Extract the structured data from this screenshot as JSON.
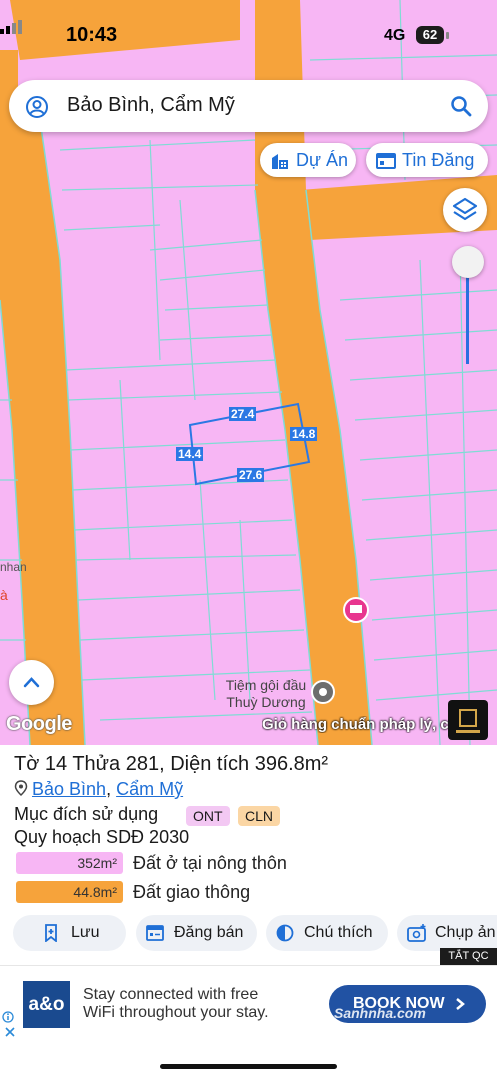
{
  "status_bar": {
    "time": "10:43",
    "network": "4G",
    "battery": "62"
  },
  "search": {
    "query": "Bảo Bình, Cẩm Mỹ",
    "avatar_icon": "account-circle-icon",
    "search_icon": "search-icon"
  },
  "map_chips": [
    {
      "label": "Dự Án",
      "icon": "building-icon"
    },
    {
      "label": "Tin Đăng",
      "icon": "listing-icon"
    }
  ],
  "map": {
    "layers_icon": "layers-icon",
    "recenter_icon": "chevron-up-icon",
    "parcel_dims": {
      "top": "27.4",
      "right": "14.8",
      "left": "14.4",
      "bottom": "27.6"
    },
    "poi_name_line1": "Tiệm gội đầu",
    "poi_name_line2": "Thuỳ Dương",
    "attribution": "Google",
    "marquee": "Giỏ hàng chuẩn pháp lý, c",
    "edge_labels": [
      "nhan",
      "à"
    ],
    "colors": {
      "residential": "#f7b6f4",
      "road": "#f6a33b",
      "parcel_line": "#7fdcd4",
      "selection": "#2b78e4"
    }
  },
  "panel": {
    "title": "Tờ 14 Thửa 281, Diện tích 396.8m²",
    "location_icon": "location-pin-icon",
    "location_1": "Bảo Bình",
    "location_sep": ",",
    "location_2": "Cẩm Mỹ",
    "purpose_label": "Mục đích sử dụng",
    "badges": [
      {
        "text": "ONT",
        "color": "#f3c8f3"
      },
      {
        "text": "CLN",
        "color": "#fbd6a4"
      }
    ],
    "plan_label": "Quy hoạch SDĐ 2030",
    "legend": [
      {
        "value": "352m²",
        "label": "Đất ở tại nông thôn",
        "color": "#f7b6f4"
      },
      {
        "value": "44.8m²",
        "label": "Đất giao thông",
        "color": "#f6a33b"
      }
    ],
    "actions": [
      {
        "label": "Lưu",
        "icon": "bookmark-add-icon"
      },
      {
        "label": "Đăng bán",
        "icon": "listing-icon"
      },
      {
        "label": "Chú thích",
        "icon": "contrast-icon"
      },
      {
        "label": "Chụp ản",
        "icon": "camera-add-icon"
      }
    ]
  },
  "ad": {
    "tag": "TẮT QC",
    "brand": "a&o",
    "line1": "Stay connected with free",
    "line2": "WiFi throughout your stay.",
    "cta": "BOOK NOW",
    "watermark": "Sanhnha.com"
  }
}
